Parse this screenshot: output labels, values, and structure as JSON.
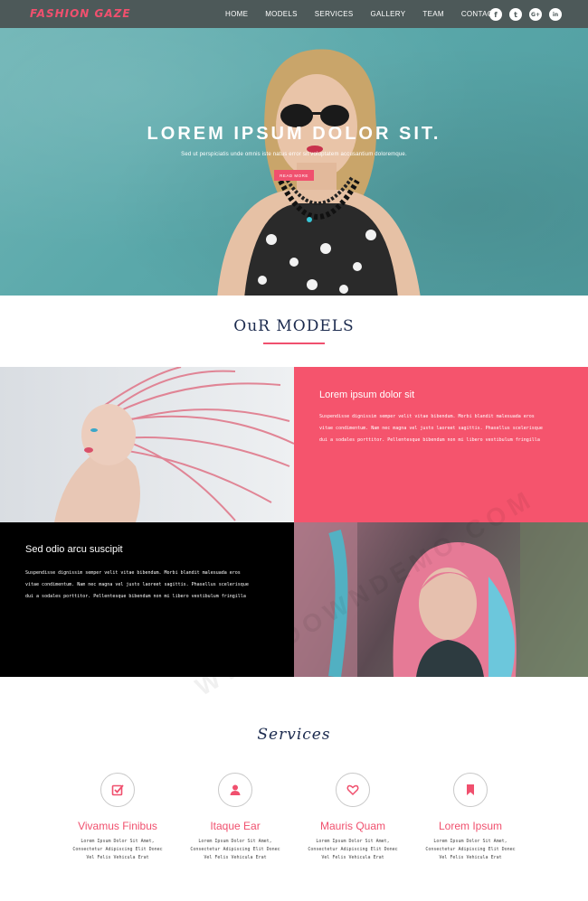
{
  "brand": {
    "logo": "FASHION GAZE",
    "accent": "#f0506e",
    "nav_bg": "#4d5959",
    "navy": "#1b2a4e"
  },
  "nav": {
    "items": [
      {
        "label": "HOME"
      },
      {
        "label": "MODELS"
      },
      {
        "label": "SERVICES"
      },
      {
        "label": "GALLERY"
      },
      {
        "label": "TEAM"
      },
      {
        "label": "CONTACT"
      }
    ],
    "social": [
      {
        "icon": "facebook-icon",
        "glyph": "f"
      },
      {
        "icon": "twitter-icon",
        "glyph": "t"
      },
      {
        "icon": "google-plus-icon",
        "glyph": "G+"
      },
      {
        "icon": "linkedin-icon",
        "glyph": "in"
      }
    ]
  },
  "hero": {
    "title": "LOREM IPSUM DOLOR SIT.",
    "subtitle": "Sed ut perspiciatis unde omnis iste natus error sit voluptatem accusantium doloremque.",
    "button": "READ MORE"
  },
  "models": {
    "title": "OuR MODELS",
    "block1": {
      "title": "Lorem ipsum dolor sit",
      "lines": [
        "Suspendisse dignissim semper velit vitae bibendum. Morbi blandit malesuada eros",
        "vitae condimentum. Nam nec magna vel justo laoreet sagittis. Phasellus scelerisque",
        "dui a sodales porttitor. Pellentesque bibendum non mi libero vestibulum fringilla"
      ]
    },
    "block2": {
      "title": "Sed odio arcu suscipit",
      "lines": [
        "Suspendisse dignissim semper velit vitae bibendum. Morbi blandit malesuada eros",
        "vitae condimentum. Nam nec magna vel justo laoreet sagittis. Phasellus scelerisque",
        "dui a sodales porttitor. Pellentesque bibendum non mi libero vestibulum fringilla"
      ]
    }
  },
  "services": {
    "title": "Services",
    "items": [
      {
        "icon": "check-square-icon",
        "name": "Vivamus Finibus",
        "lines": [
          "Lorem Ipsum Dolor Sit Amet,",
          "Consectetur Adipiscing Elit Donec",
          "Vel Felis Vehicula Erat"
        ]
      },
      {
        "icon": "user-icon",
        "name": "Itaque Ear",
        "lines": [
          "Lorem Ipsum Dolor Sit Amet,",
          "Consectetur Adipiscing Elit Donec",
          "Vel Felis Vehicula Erat"
        ]
      },
      {
        "icon": "heart-icon",
        "name": "Mauris Quam",
        "lines": [
          "Lorem Ipsum Dolor Sit Amet,",
          "Consectetur Adipiscing Elit Donec",
          "Vel Felis Vehicula Erat"
        ]
      },
      {
        "icon": "bookmark-icon",
        "name": "Lorem Ipsum",
        "lines": [
          "Lorem Ipsum Dolor Sit Amet,",
          "Consectetur Adipiscing Elit Donec",
          "Vel Felis Vehicula Erat"
        ]
      }
    ]
  },
  "watermark": "WWW.DOWNDEMO.COM"
}
